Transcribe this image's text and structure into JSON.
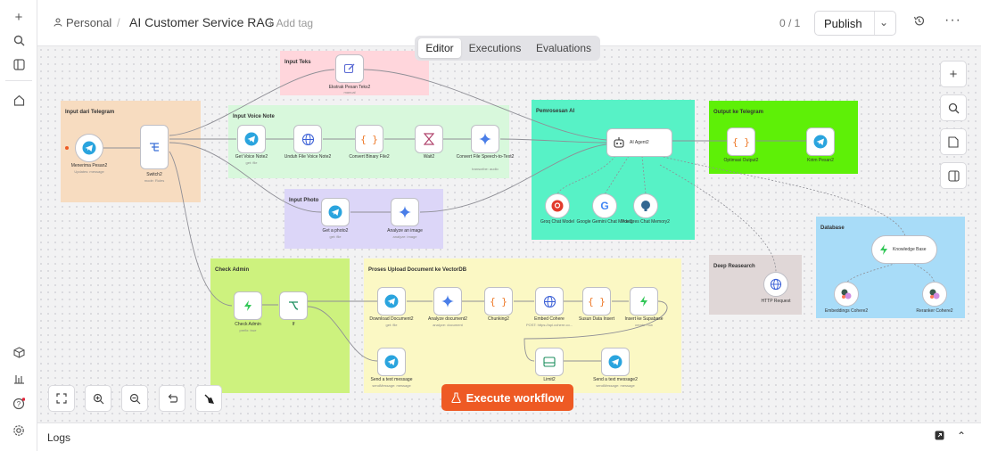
{
  "sidebar": {
    "icons": [
      "plus-icon",
      "search-icon",
      "panel-icon",
      "home-icon",
      "cube-icon",
      "chart-icon",
      "help-icon",
      "gear-icon"
    ]
  },
  "header": {
    "breadcrumb_project": "Personal",
    "breadcrumb_sep": "/",
    "title": "AI Customer Service RAG",
    "add_tag": "+ Add tag",
    "counter": "0 / 1",
    "publish_label": "Publish"
  },
  "tabs": [
    "Editor",
    "Executions",
    "Evaluations"
  ],
  "stickies": {
    "input_teks": "Input Teks",
    "input_telegram": "Input dari Telegram",
    "input_voice": "Input Voice Note",
    "input_photo": "Input Photo",
    "pemrosesan": "Pemrosesan AI",
    "output_telegram": "Output ke Telegram",
    "database": "Database",
    "deep_research": "Deep Reasearch",
    "check_admin": "Check Admin",
    "proses_upload": "Proses Upload Document ke VectorDB"
  },
  "nodes": {
    "ekstrak": {
      "label": "Ekstrak Pesan Teks2",
      "sub": "manual"
    },
    "menerima": {
      "label": "Menerima Pesan2",
      "sub": "Updates: message"
    },
    "switch": {
      "label": "Switch2",
      "sub": "mode: Rules"
    },
    "get_voice": {
      "label": "Get Voice Note2",
      "sub": "get: file"
    },
    "unduh": {
      "label": "Unduh File Voice Note2",
      "sub": ""
    },
    "convert_binary": {
      "label": "Convert Binary File2",
      "sub": ""
    },
    "wait": {
      "label": "Wait2",
      "sub": ""
    },
    "convert_speech": {
      "label": "Convert File Speech-to-Text2",
      "sub": "transcribe: audio"
    },
    "get_photo": {
      "label": "Get a photo2",
      "sub": "get: file"
    },
    "analyze_image": {
      "label": "Analyze an image",
      "sub": "analyze: image"
    },
    "ai_agent": {
      "label": "AI Agent2",
      "sub": ""
    },
    "groq": {
      "label": "Groq Chat Model",
      "sub": ""
    },
    "gemini": {
      "label": "Google Gemini Chat Model1",
      "sub": ""
    },
    "postgres": {
      "label": "Postgres Chat Memory2",
      "sub": ""
    },
    "optimasi": {
      "label": "Optimasi Output2",
      "sub": ""
    },
    "kirim": {
      "label": "Kirim Pesan2",
      "sub": ""
    },
    "knowledge": {
      "label": "Knowledge Base",
      "sub": ""
    },
    "embeddings": {
      "label": "Embeddings Cohere2",
      "sub": ""
    },
    "reranker": {
      "label": "Reranker Cohere2",
      "sub": ""
    },
    "http": {
      "label": "HTTP Request",
      "sub": ""
    },
    "check_admin": {
      "label": "Check Admin",
      "sub": "prefix: true"
    },
    "if_node": {
      "label": "If",
      "sub": ""
    },
    "download": {
      "label": "Download Document2",
      "sub": "get: file"
    },
    "analyze_doc": {
      "label": "Analyze document2",
      "sub": "analyze: document"
    },
    "chunking": {
      "label": "Chunking2",
      "sub": ""
    },
    "embed": {
      "label": "Embed Cohere",
      "sub": "POST: https://api.cohere.co..."
    },
    "susun": {
      "label": "Susun Data Insert",
      "sub": ""
    },
    "insert": {
      "label": "Insert ke Supabase",
      "sub": "create: row"
    },
    "send_text": {
      "label": "Send a text message",
      "sub": "sendMessage: message"
    },
    "limit": {
      "label": "Limit2",
      "sub": ""
    },
    "send_text2": {
      "label": "Send a text message2",
      "sub": "sendMessage: message"
    }
  },
  "execute_label": "Execute workflow",
  "logs_label": "Logs",
  "colors": {
    "accent": "#ee5a24",
    "sticky_pink": "#ffd6dc",
    "sticky_orange": "#f7dcc0",
    "sticky_green_light": "#d8f8dc",
    "sticky_purple": "#dcd6f8",
    "sticky_teal": "#57f2c6",
    "sticky_lime": "#5ef007",
    "sticky_blue": "#a8dcf8",
    "sticky_gray": "#e0d7d7",
    "sticky_yellowgreen": "#cdf27e",
    "sticky_yellow": "#fbf8c4"
  }
}
